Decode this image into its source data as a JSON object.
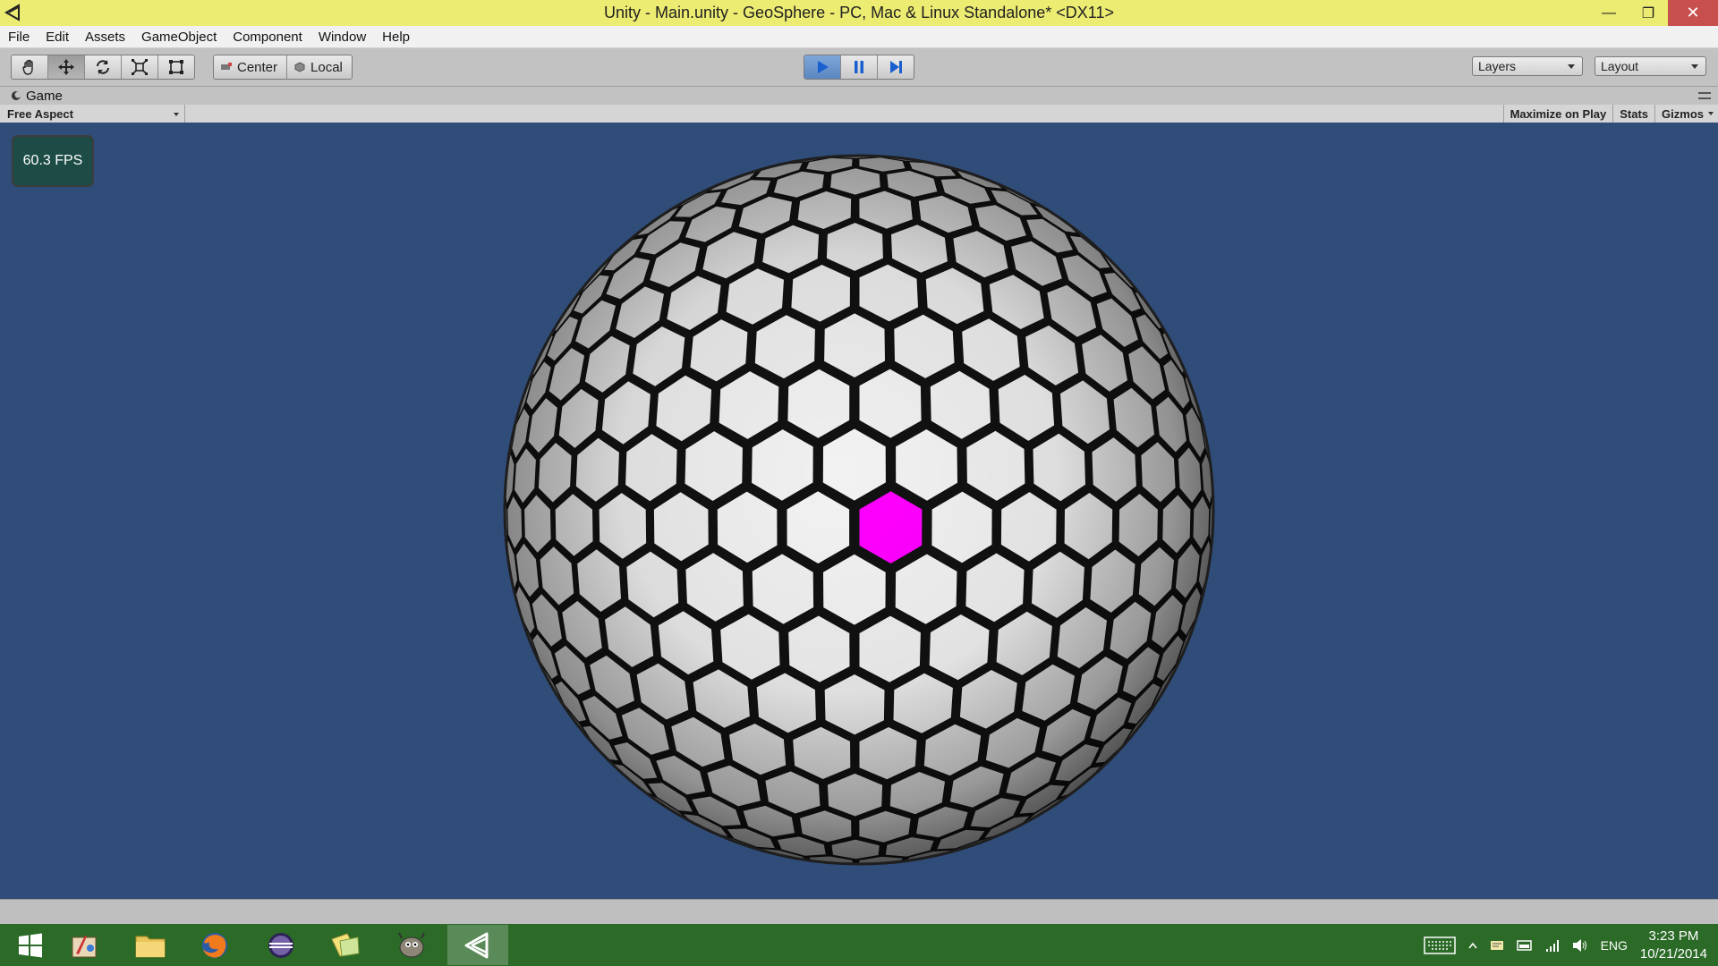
{
  "window": {
    "title": "Unity - Main.unity - GeoSphere - PC, Mac & Linux Standalone* <DX11>",
    "minimize": "—",
    "maximize": "❐",
    "close": "✕"
  },
  "menu": [
    "File",
    "Edit",
    "Assets",
    "GameObject",
    "Component",
    "Window",
    "Help"
  ],
  "toolbar": {
    "tools": [
      "hand-tool-icon",
      "move-tool-icon",
      "rotate-tool-icon",
      "scale-tool-icon",
      "rect-tool-icon"
    ],
    "active_tool": "move-tool-icon",
    "pivot_mode": "Center",
    "pivot_space": "Local",
    "play_state": "playing",
    "layers_label": "Layers",
    "layout_label": "Layout"
  },
  "game_view": {
    "tab_label": "Game",
    "aspect": "Free Aspect",
    "maximize_on_play": "Maximize on Play",
    "stats": "Stats",
    "gizmos": "Gizmos",
    "fps": "60.3 FPS",
    "background_color": "#304c78",
    "tile_color": "#f2f2f2",
    "selected_tile_color": "#ff00ff",
    "edge_color": "#111111"
  },
  "taskbar": {
    "apps": [
      "windows-start-icon",
      "paint-app-icon",
      "file-explorer-icon",
      "firefox-icon",
      "eclipse-icon",
      "notes-app-icon",
      "gimp-icon",
      "unity-icon"
    ],
    "active_app": "unity-icon",
    "language": "ENG",
    "time": "3:23 PM",
    "date": "10/21/2014"
  }
}
